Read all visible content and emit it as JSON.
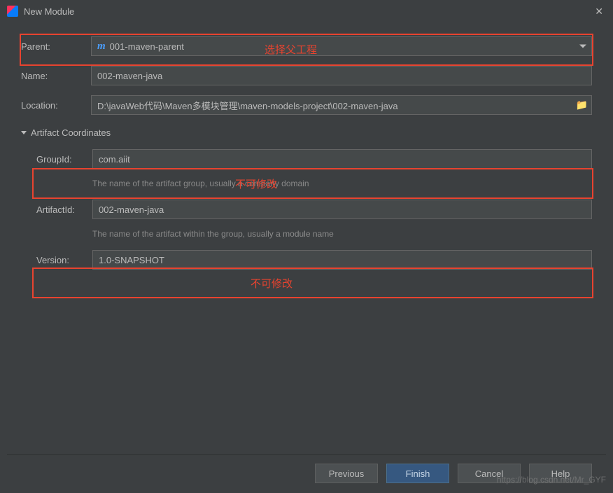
{
  "window": {
    "title": "New Module"
  },
  "form": {
    "parent": {
      "label": "Parent:",
      "value": "001-maven-parent"
    },
    "name": {
      "label": "Name:",
      "value": "002-maven-java"
    },
    "location": {
      "label": "Location:",
      "value": "D:\\javaWeb代码\\Maven多模块管理\\maven-models-project\\002-maven-java"
    }
  },
  "coordinates": {
    "header": "Artifact Coordinates",
    "groupId": {
      "label": "GroupId:",
      "value": "com.aiit",
      "help": "The name of the artifact group, usually a company domain"
    },
    "artifactId": {
      "label": "ArtifactId:",
      "value": "002-maven-java",
      "help": "The name of the artifact within the group, usually a module name"
    },
    "version": {
      "label": "Version:",
      "value": "1.0-SNAPSHOT"
    }
  },
  "buttons": {
    "previous": "Previous",
    "finish": "Finish",
    "cancel": "Cancel",
    "help": "Help"
  },
  "annotations": {
    "parent_hint": "选择父工程",
    "not_editable": "不可修改"
  },
  "watermark": "https://blog.csdn.net/Mr_GYF"
}
